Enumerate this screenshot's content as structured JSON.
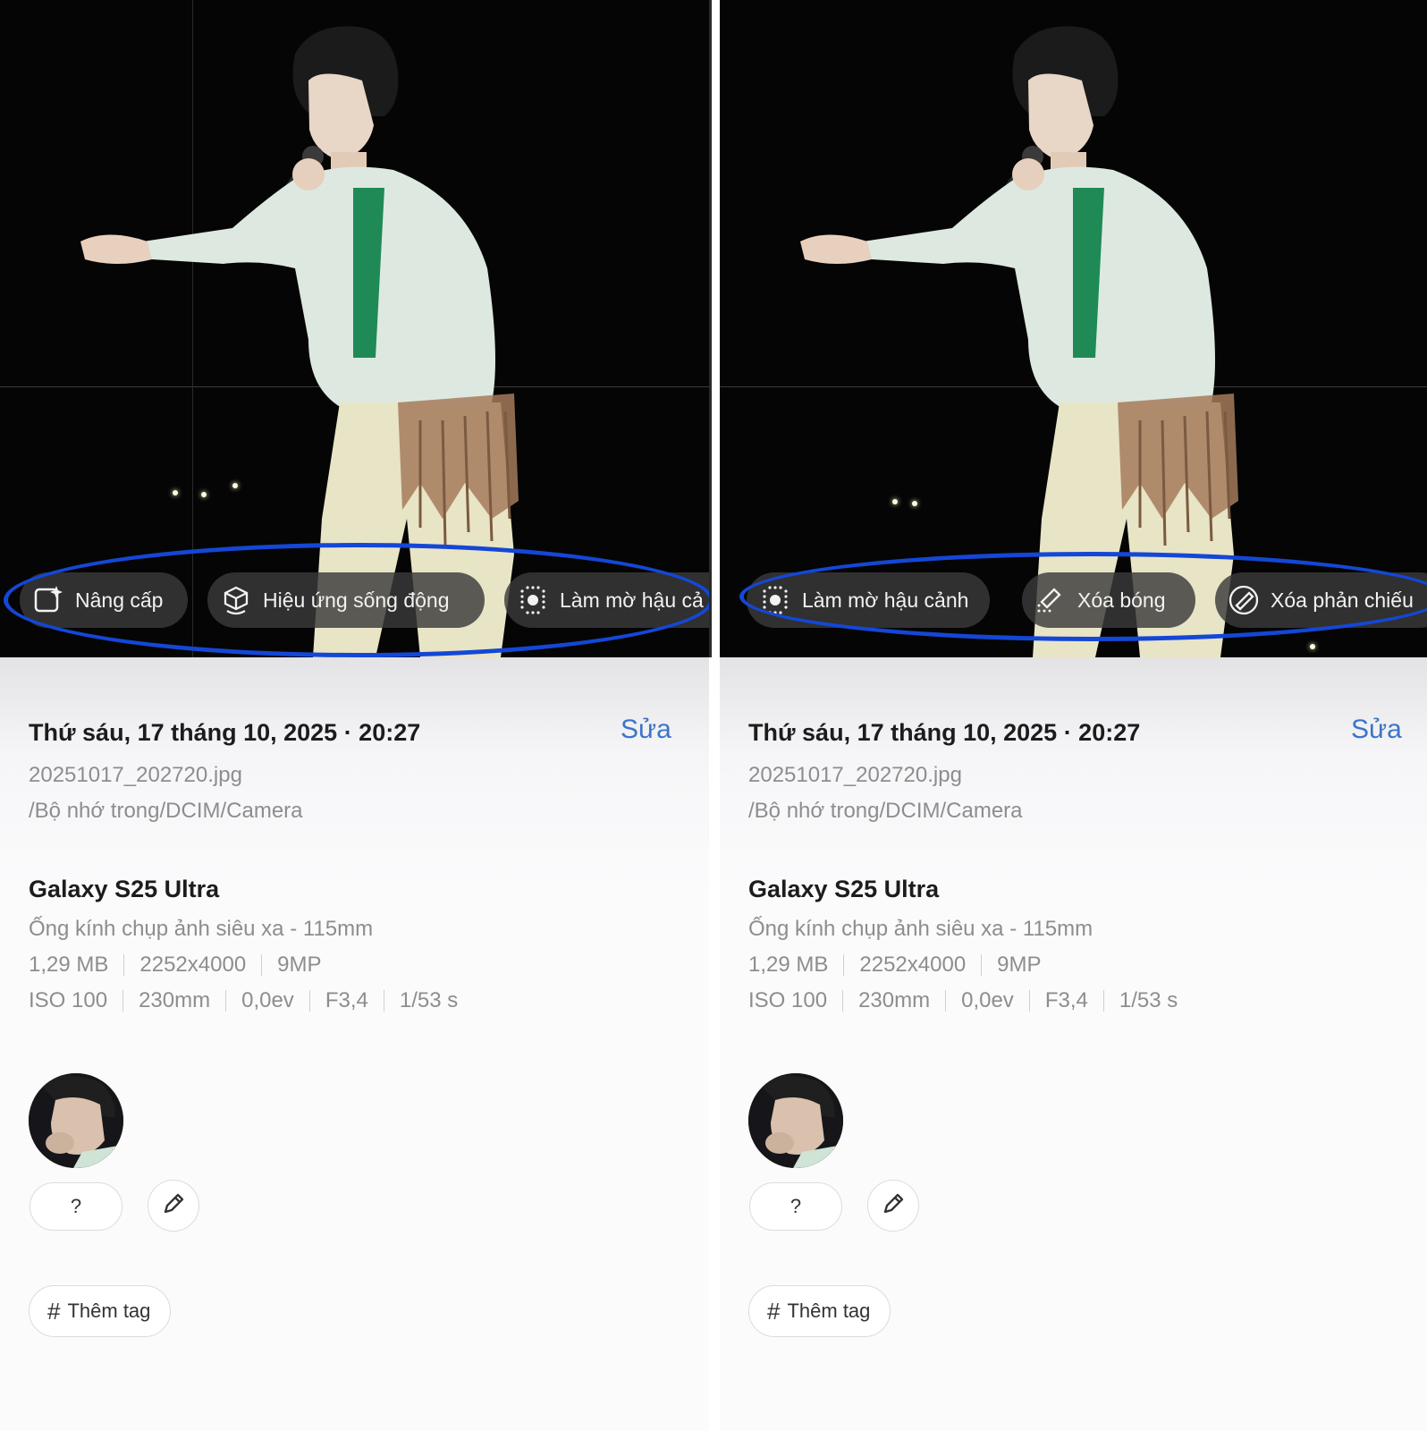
{
  "left": {
    "chips": [
      {
        "icon": "sparkle-enhance-icon",
        "label": "Nâng cấp"
      },
      {
        "icon": "cube-motion-icon",
        "label": "Hiệu ứng sống động"
      },
      {
        "icon": "background-blur-icon",
        "label": "Làm mờ hậu cả"
      }
    ],
    "date": "Thứ sáu, 17 tháng 10, 2025 · 20:27",
    "edit_label": "Sửa",
    "filename": "20251017_202720.jpg",
    "path": "/Bộ nhớ trong/DCIM/Camera",
    "device": "Galaxy S25 Ultra",
    "lens": "Ống kính chụp ảnh siêu xa - 115mm",
    "specs1": [
      "1,29 MB",
      "2252x4000",
      "9MP"
    ],
    "specs2": [
      "ISO 100",
      "230mm",
      "0,0ev",
      "F3,4",
      "1/53 s"
    ],
    "unknown_person": "?",
    "add_tag": "Thêm tag",
    "hash": "#"
  },
  "right": {
    "chips": [
      {
        "icon": "background-blur-icon",
        "label": "Làm mờ hậu cảnh"
      },
      {
        "icon": "shadow-eraser-icon",
        "label": "Xóa bóng"
      },
      {
        "icon": "reflection-eraser-icon",
        "label": "Xóa phản chiếu"
      }
    ],
    "date": "Thứ sáu, 17 tháng 10, 2025 · 20:27",
    "edit_label": "Sửa",
    "filename": "20251017_202720.jpg",
    "path": "/Bộ nhớ trong/DCIM/Camera",
    "device": "Galaxy S25 Ultra",
    "lens": "Ống kính chụp ảnh siêu xa - 115mm",
    "specs1": [
      "1,29 MB",
      "2252x4000",
      "9MP"
    ],
    "specs2": [
      "ISO 100",
      "230mm",
      "0,0ev",
      "F3,4",
      "1/53 s"
    ],
    "unknown_person": "?",
    "add_tag": "Thêm tag",
    "hash": "#"
  },
  "colors": {
    "highlight": "#1447d6",
    "link": "#3c74c9",
    "chip_bg": "#3a3a3a"
  }
}
